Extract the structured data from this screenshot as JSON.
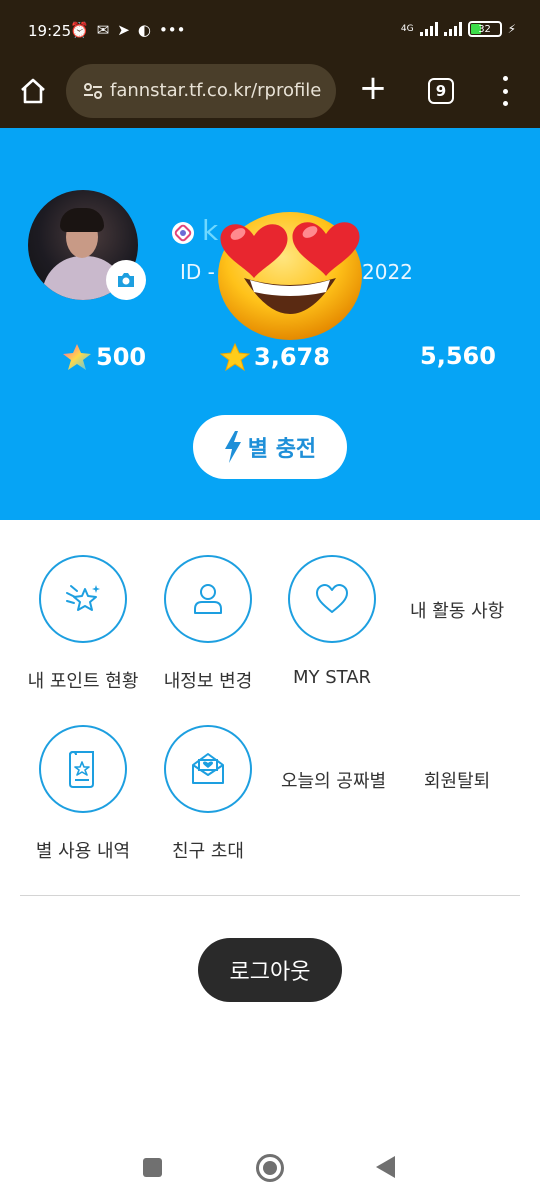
{
  "status_bar": {
    "time": "19:25",
    "network": "4G",
    "battery": "32"
  },
  "browser": {
    "url": "fannstar.tf.co.kr/rprofile",
    "tab_count": "9"
  },
  "profile": {
    "username": "k",
    "id_prefix": "ID - f",
    "id_suffix": "2022"
  },
  "stats": [
    {
      "value": "500",
      "icon": "rainbow-star-icon"
    },
    {
      "value": "3,678",
      "icon": "yellow-star-icon"
    },
    {
      "value": "5,560"
    }
  ],
  "charge_button": {
    "label": "별 충전",
    "icon": "lightning-icon"
  },
  "menu": {
    "point_status": "내 포인트 현황",
    "edit_info": "내정보 변경",
    "my_star": "MY STAR",
    "my_activity": "내 활동 사항",
    "star_history": "별 사용 내역",
    "invite_friend": "친구 초대",
    "free_star_today": "오늘의 공짜별",
    "withdraw": "회원탈퇴"
  },
  "logout_label": "로그아웃",
  "colors": {
    "hero_bg": "#06a4f5",
    "accent": "#1d9fe0",
    "browser_bg": "#2a1f10",
    "logout_bg": "#2a2a2a"
  }
}
